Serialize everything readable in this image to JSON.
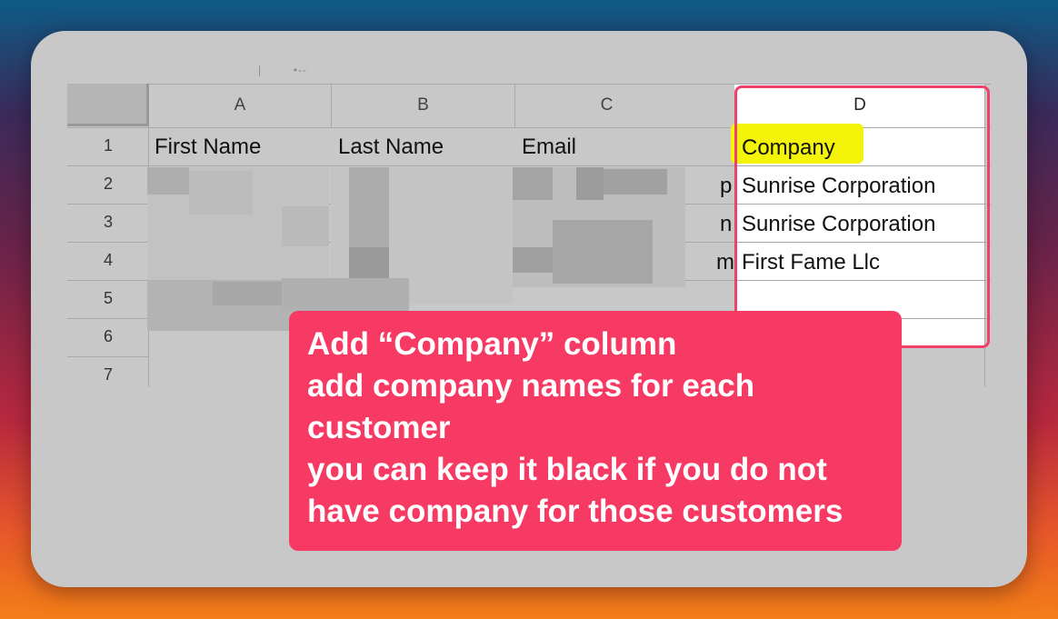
{
  "sheet": {
    "columns": [
      "A",
      "B",
      "C",
      "D"
    ],
    "rows": [
      "1",
      "2",
      "3",
      "4",
      "5",
      "6",
      "7"
    ],
    "header_cells": {
      "first_name": "First Name",
      "last_name": "Last Name",
      "email": "Email",
      "company": "Company"
    },
    "company_values": [
      "Sunrise Corporation",
      "Sunrise Corporation",
      "First Fame Llc"
    ],
    "email_tail_fragments": [
      "p",
      "n",
      "m"
    ]
  },
  "callout": {
    "lines": [
      "Add “Company” column",
      "add company names for each",
      "customer",
      "you can keep it black if you do not",
      "have company for those customers"
    ]
  },
  "colors": {
    "accent": "#f73a64",
    "outline": "#f0416a",
    "highlight": "#f4f408"
  }
}
